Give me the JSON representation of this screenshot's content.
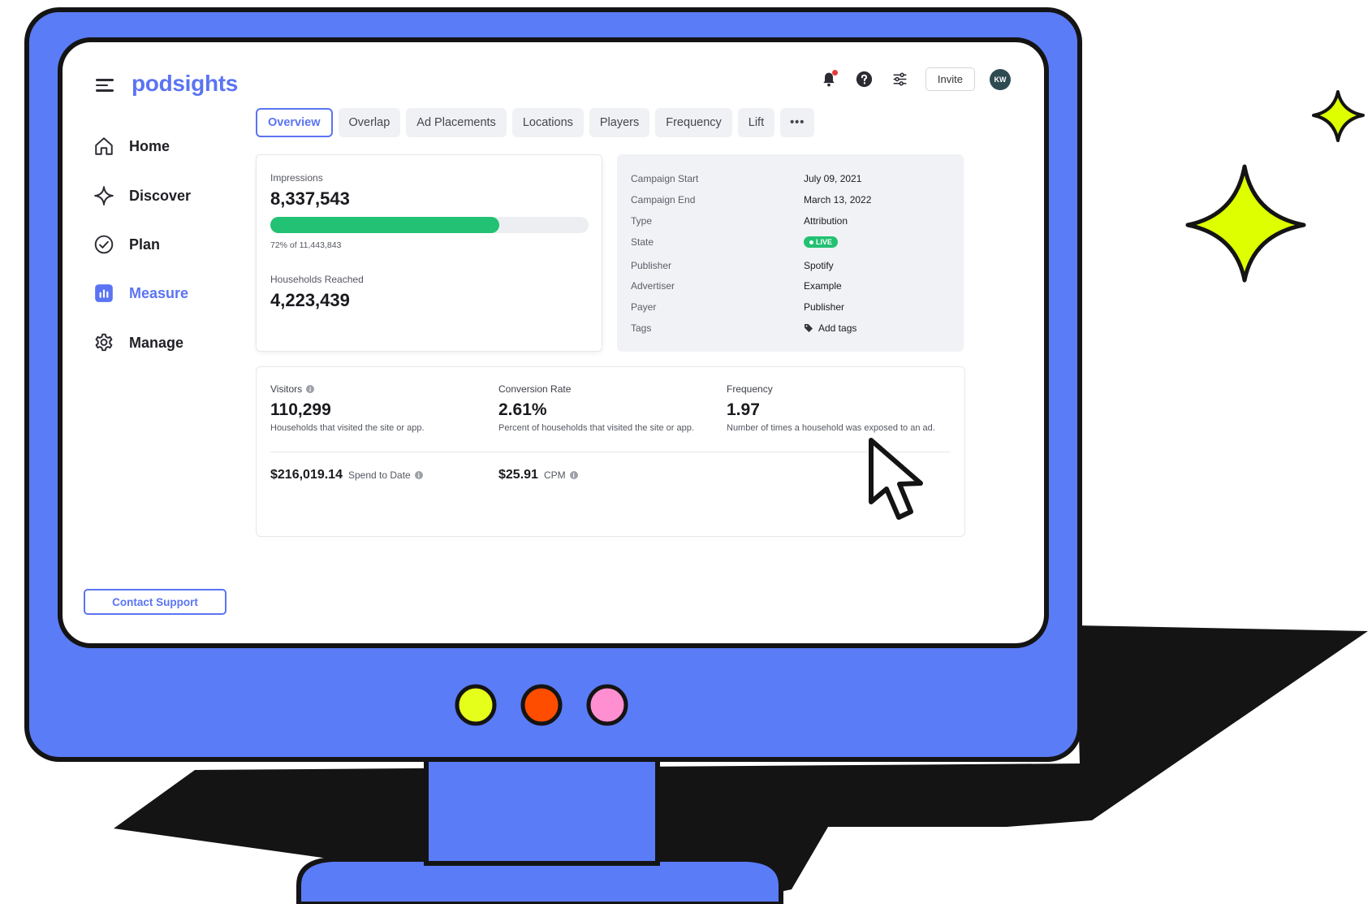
{
  "app": {
    "logo": "podsights"
  },
  "sidebar": {
    "items": [
      {
        "label": "Home",
        "icon": "home-icon",
        "active": false
      },
      {
        "label": "Discover",
        "icon": "sparkle-icon",
        "active": false
      },
      {
        "label": "Plan",
        "icon": "check-circle-icon",
        "active": false
      },
      {
        "label": "Measure",
        "icon": "bar-chart-icon",
        "active": true
      },
      {
        "label": "Manage",
        "icon": "gear-icon",
        "active": false
      }
    ],
    "contact_support": "Contact Support"
  },
  "topbar": {
    "icons": [
      "bell-icon",
      "help-icon",
      "sliders-icon"
    ],
    "invite_label": "Invite",
    "avatar_initials": "KW"
  },
  "tabs": [
    {
      "label": "Overview",
      "active": true
    },
    {
      "label": "Overlap",
      "active": false
    },
    {
      "label": "Ad Placements",
      "active": false
    },
    {
      "label": "Locations",
      "active": false
    },
    {
      "label": "Players",
      "active": false
    },
    {
      "label": "Frequency",
      "active": false
    },
    {
      "label": "Lift",
      "active": false
    },
    {
      "label": "•••",
      "active": false
    }
  ],
  "impressions": {
    "label": "Impressions",
    "value": "8,337,543",
    "progress": 0.72,
    "progress_label": "72% of 11,443,843",
    "households_label": "Households Reached",
    "households_value": "4,223,439"
  },
  "details": [
    {
      "key": "Campaign Start",
      "value": "July 09, 2021"
    },
    {
      "key": "Campaign End",
      "value": "March 13, 2022"
    },
    {
      "key": "Type",
      "value": "Attribution"
    },
    {
      "key": "State",
      "value": "LIVE"
    },
    {
      "key": "Publisher",
      "value": "Spotify"
    },
    {
      "key": "Advertiser",
      "value": "Example"
    },
    {
      "key": "Payer",
      "value": "Publisher"
    },
    {
      "key": "Tags",
      "value": "Add tags"
    }
  ],
  "metrics": {
    "visitors": {
      "label": "Visitors",
      "value": "110,299",
      "desc": "Households that visited the site or app."
    },
    "conversion": {
      "label": "Conversion Rate",
      "value": "2.61%",
      "desc": "Percent of households that visited the site or app."
    },
    "frequency": {
      "label": "Frequency",
      "value": "1.97",
      "desc": "Number of times a household was exposed to an ad."
    },
    "spend": {
      "value": "$216,019.14",
      "label": "Spend to Date"
    },
    "cpm": {
      "value": "$25.91",
      "label": "CPM"
    }
  },
  "colors": {
    "accent": "#5b74f3",
    "monitor_blue": "#5b7cf7",
    "outline": "#141414",
    "spark_yellow": "#deff00",
    "button_yellow": "#e6ff1a",
    "button_red": "#ff4d00",
    "button_pink": "#ff8fd0",
    "progress_green": "#22c173"
  }
}
